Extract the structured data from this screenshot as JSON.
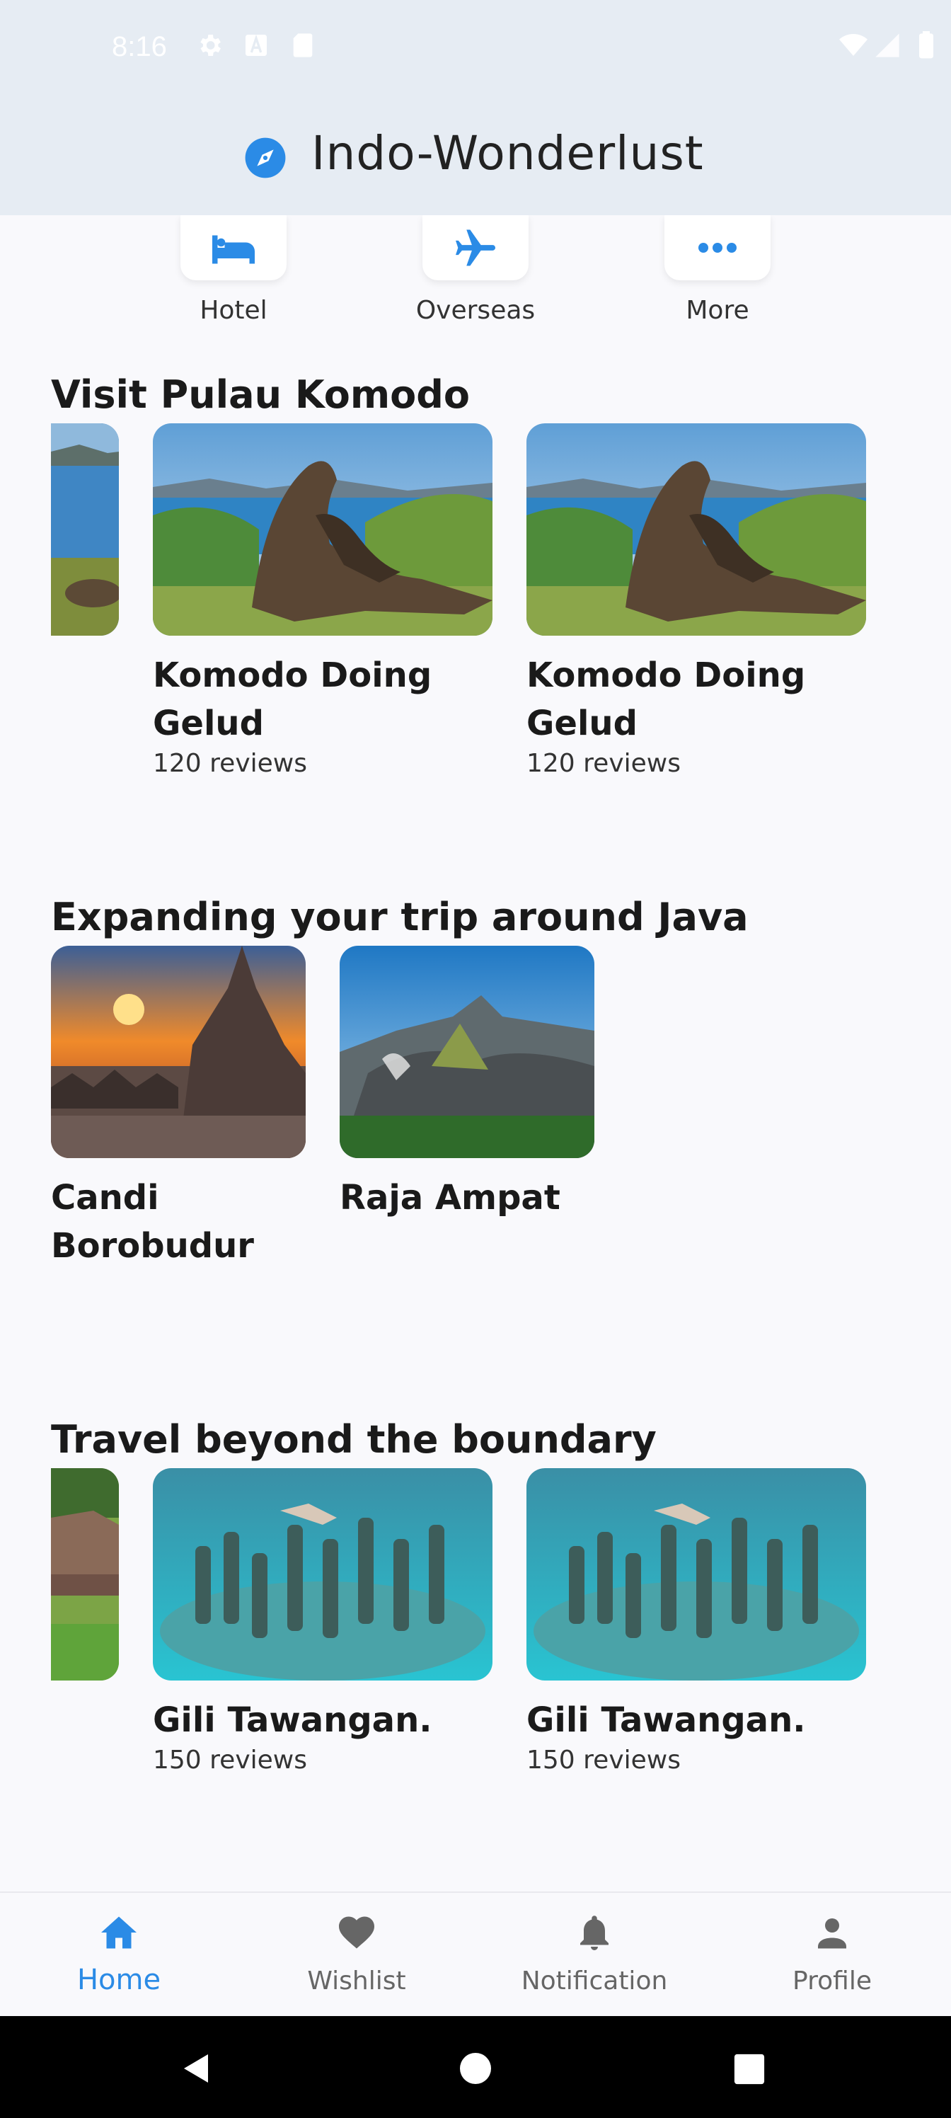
{
  "status_bar": {
    "time": "8:16"
  },
  "app_bar": {
    "title": "Indo-Wonderlust"
  },
  "categories": [
    {
      "label": "Hotel",
      "icon": "hotel-icon"
    },
    {
      "label": "Overseas",
      "icon": "airplane-icon"
    },
    {
      "label": "More",
      "icon": "more-icon"
    }
  ],
  "sections": [
    {
      "title": "Visit Pulau Komodo",
      "cards": [
        {
          "name": "Komodo Doing Gelud",
          "reviews": "120 reviews"
        },
        {
          "name": "Komodo Doing Gelud",
          "reviews": "120 reviews"
        }
      ]
    },
    {
      "title": "Expanding your trip around Java",
      "cards": [
        {
          "name": "Candi Borobudur"
        },
        {
          "name": "Raja Ampat"
        }
      ]
    },
    {
      "title": "Travel beyond the boundary",
      "cards": [
        {
          "name": "Gili Tawangan.",
          "reviews": "150 reviews"
        },
        {
          "name": "Gili Tawangan.",
          "reviews": "150 reviews"
        }
      ]
    }
  ],
  "bottom_nav": [
    {
      "label": "Home",
      "icon": "home-icon",
      "active": true
    },
    {
      "label": "Wishlist",
      "icon": "heart-icon"
    },
    {
      "label": "Notification",
      "icon": "bell-icon"
    },
    {
      "label": "Profile",
      "icon": "person-icon"
    }
  ],
  "colors": {
    "accent": "#2b8be6",
    "app_bar": "#e6ecf3",
    "background": "#f9f9fc"
  }
}
